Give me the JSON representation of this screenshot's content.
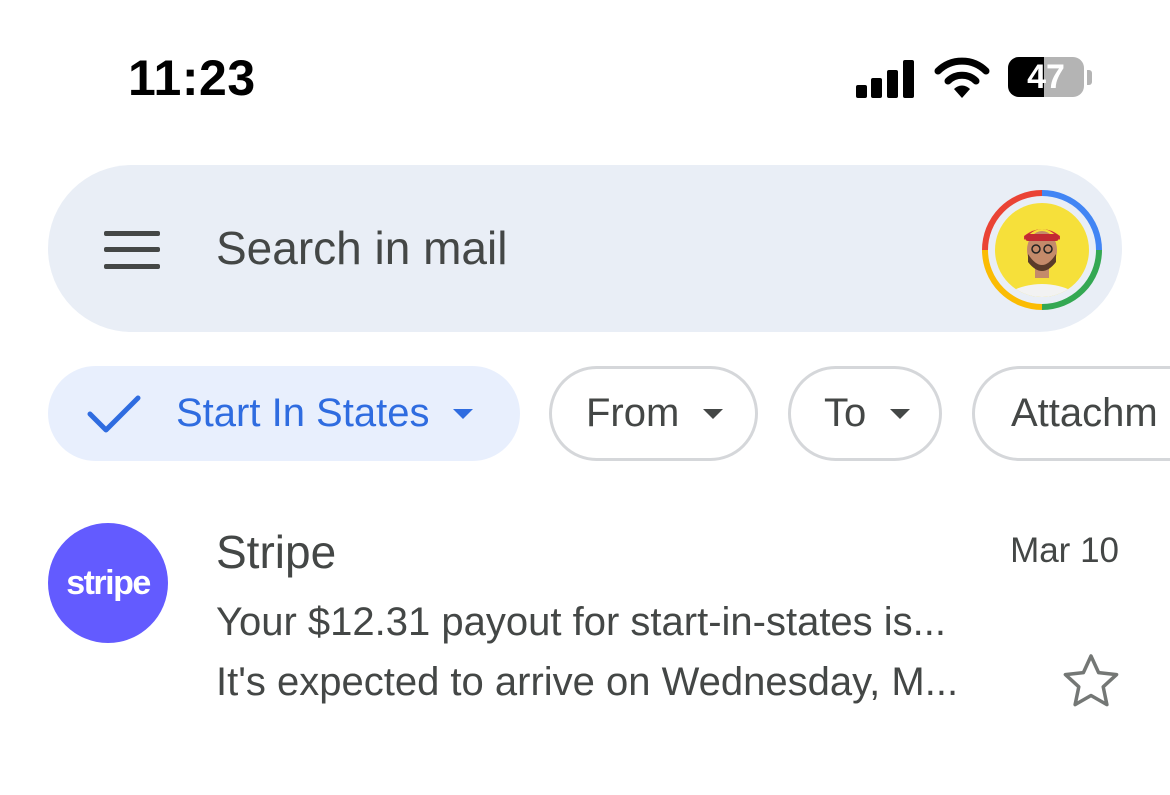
{
  "status_bar": {
    "time": "11:23",
    "battery_level": "47",
    "battery_fraction": 0.47,
    "icons": [
      "cellular-signal-icon",
      "wifi-icon",
      "battery-icon"
    ]
  },
  "search": {
    "placeholder": "Search in mail",
    "menu_icon": "hamburger-menu-icon",
    "account_icon": "account-avatar"
  },
  "filters": [
    {
      "label": "Start In States",
      "selected": true,
      "icon": "check-icon"
    },
    {
      "label": "From",
      "selected": false
    },
    {
      "label": "To",
      "selected": false
    },
    {
      "label": "Attachm",
      "selected": false
    }
  ],
  "emails": [
    {
      "sender": "Stripe",
      "avatar_text": "stripe",
      "avatar_color": "#635bff",
      "date": "Mar 10",
      "subject": "Your $12.31 payout for start-in-states is...",
      "preview": "It's expected to arrive on Wednesday, M...",
      "starred": false
    }
  ],
  "colors": {
    "accent_blue": "#2f6ce0",
    "search_bg": "#e9eef6",
    "chip_active_bg": "#e8effd",
    "stripe_purple": "#635bff"
  }
}
